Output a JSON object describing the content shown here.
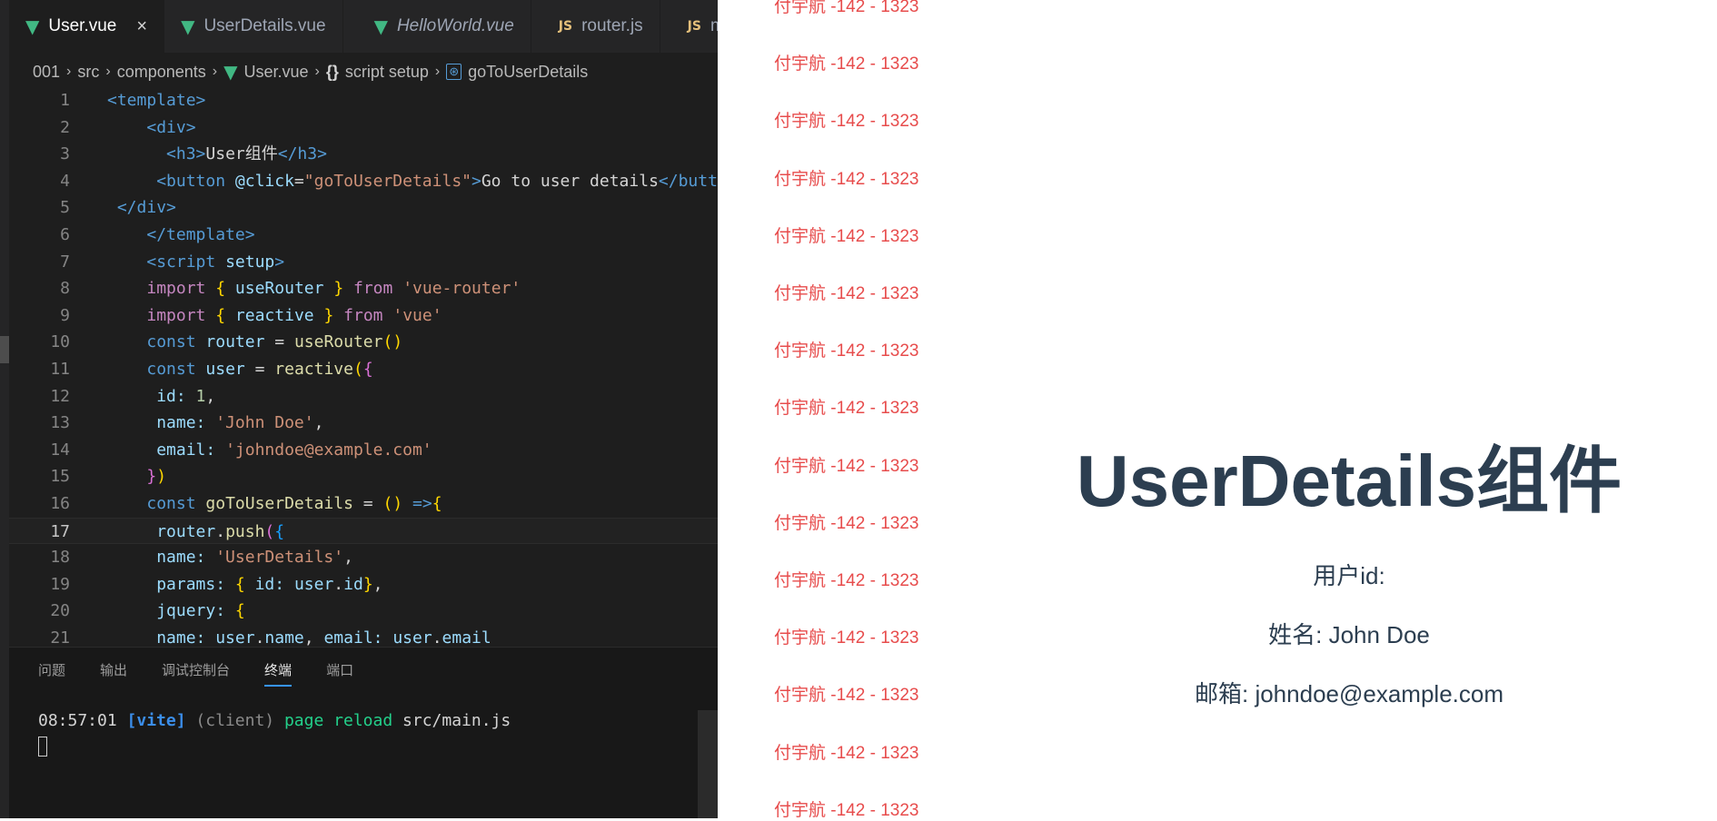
{
  "editor": {
    "tabs": [
      {
        "icon": "vue-icon",
        "label": "User.vue",
        "active": true,
        "close": "×"
      },
      {
        "icon": "vue-icon",
        "label": "UserDetails.vue"
      },
      {
        "icon": "vue-icon",
        "label": "HelloWorld.vue",
        "italic": true
      },
      {
        "icon": "js-icon",
        "label": "router.js"
      },
      {
        "icon": "js-icon",
        "label": "main.js"
      }
    ],
    "breadcrumb": [
      "001",
      "src",
      "components",
      "User.vue",
      "script setup",
      "goToUserDetails"
    ],
    "code": {
      "l1": "<template>",
      "l2": "<div>",
      "l3a": "<h3>",
      "l3b": "User组件",
      "l3c": "</h3>",
      "l4a": "<button",
      "l4b": "@click",
      "l4c": "=",
      "l4d": "\"goToUserDetails\"",
      "l4e": ">",
      "l4f": "Go to user details",
      "l4g": "</button>",
      "l5": "</div>",
      "l6": "</template>",
      "l7a": "<script",
      "l7b": "setup",
      "l7c": ">",
      "l8a": "import",
      "l8b": "{",
      "l8c": "useRouter",
      "l8d": "}",
      "l8e": "from",
      "l8f": "'vue-router'",
      "l9a": "import",
      "l9b": "{",
      "l9c": "reactive",
      "l9d": "}",
      "l9e": "from",
      "l9f": "'vue'",
      "l10a": "const",
      "l10b": "router",
      "l10c": "=",
      "l10d": "useRouter",
      "l10e": "()",
      "l11a": "const",
      "l11b": "user",
      "l11c": "=",
      "l11d": "reactive",
      "l11e": "(",
      "l11f": "{",
      "l12a": "id:",
      "l12b": "1",
      "l13a": "name:",
      "l13b": "'John Doe'",
      "l14a": "email:",
      "l14b": "'johndoe@example.com'",
      "l15a": "}",
      "l15b": ")",
      "l16a": "const",
      "l16b": "goToUserDetails",
      "l16c": "=",
      "l16d": "()",
      "l16e": "=>",
      "l16f": "{",
      "l17a": "router",
      "l17b": ".",
      "l17c": "push",
      "l17d": "(",
      "l17e": "{",
      "l18a": "name:",
      "l18b": "'UserDetails'",
      "l19a": "params:",
      "l19b": "{",
      "l19c": "id:",
      "l19d": "user",
      "l19e": ".",
      "l19f": "id",
      "l19g": "}",
      "l20a": "jquery:",
      "l20b": "{",
      "l21a": "name:",
      "l21b": "user",
      "l21c": ".",
      "l21d": "name",
      "l21e": "email:",
      "l21f": "user",
      "l21g": ".",
      "l21h": "email"
    },
    "line_numbers": [
      "1",
      "2",
      "3",
      "4",
      "5",
      "6",
      "7",
      "8",
      "9",
      "10",
      "11",
      "12",
      "13",
      "14",
      "15",
      "16",
      "17",
      "18",
      "19",
      "20",
      "21"
    ],
    "current_line": 17,
    "panel": {
      "tabs": [
        "问题",
        "输出",
        "调试控制台",
        "终端",
        "端口"
      ],
      "active_tab": "终端",
      "terminal": {
        "time": "08:57:01",
        "tool": "[vite]",
        "source": "(client)",
        "message": "page reload",
        "file": "src/main.js"
      }
    }
  },
  "watermark": {
    "text": "付宇航 -142 - 1323",
    "count": 15
  },
  "preview": {
    "title": "UserDetails组件",
    "id_line": "用户id:",
    "name_line": "姓名: John Doe",
    "email_line": "邮箱: johndoe@example.com"
  },
  "colors": {
    "editor_bg": "#1e1e1e",
    "vue_green": "#41b883",
    "watermark_red": "#e74c4c",
    "heading": "#2c3e50"
  }
}
